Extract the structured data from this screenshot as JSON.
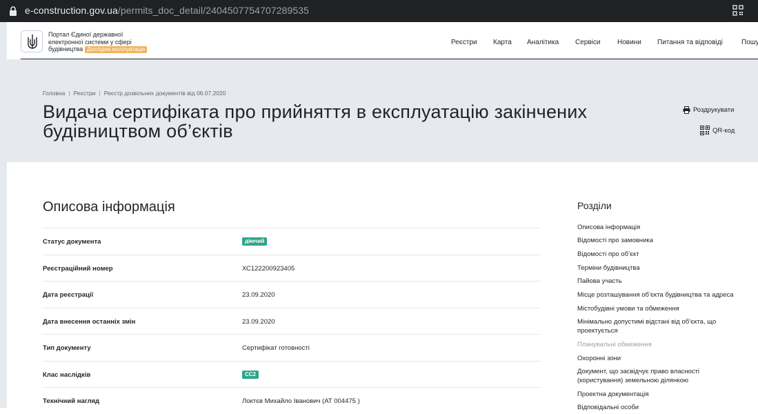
{
  "browser": {
    "url_host": "e-construction.gov.ua",
    "url_path": "/permits_doc_detail/2404507754707289535",
    "lock_icon": "lock-icon",
    "qr_icon": "qr-code-icon"
  },
  "header": {
    "logo_icon": "trident-icon",
    "portal_title": "Портал Єдиної державної електронної системи у сфері будівництва",
    "badge": "Дослідна експлуатація",
    "nav": [
      "Реєстри",
      "Карта",
      "Аналітика",
      "Сервіси",
      "Новини",
      "Питання та відповіді",
      "Пошу"
    ]
  },
  "hero": {
    "breadcrumb": [
      "Головна",
      "Реєстри",
      "Реєстр дозвільних документів від 06.07.2020"
    ],
    "title": "Видача сертифіката про прийняття в експлуатацію закінчених будівництвом об’єктів",
    "print_label": "Роздрукувати",
    "print_icon": "printer-icon",
    "qr_label": "QR-код",
    "qr_icon": "qr-code-icon"
  },
  "main": {
    "section_title": "Описова інформація",
    "rows": [
      {
        "label": "Статус документа",
        "value": "діючий",
        "type": "badge"
      },
      {
        "label": "Реєстраційний номер",
        "value": "ХС122200923405",
        "type": "text"
      },
      {
        "label": "Дата реєстрації",
        "value": "23.09.2020",
        "type": "text"
      },
      {
        "label": "Дата внесення останніх змін",
        "value": "23.09.2020",
        "type": "text"
      },
      {
        "label": "Тип документу",
        "value": "Сертифікат готовності",
        "type": "text"
      },
      {
        "label": "Клас наслідків",
        "value": "СС2",
        "type": "badge"
      },
      {
        "label": "Технічний нагляд",
        "value": "Локтєв Михайло Іванович (АТ 004475 )",
        "type": "text"
      }
    ]
  },
  "toc": {
    "title": "Розділи",
    "items": [
      {
        "label": "Описова інформація",
        "muted": false
      },
      {
        "label": "Відомості про замовника",
        "muted": false
      },
      {
        "label": "Відомості про об’єкт",
        "muted": false
      },
      {
        "label": "Терміни будівництва",
        "muted": false
      },
      {
        "label": "Пайова участь",
        "muted": false
      },
      {
        "label": "Місце розташування об’єкта будівництва та адреса",
        "muted": false
      },
      {
        "label": "Містобудівні умови та обмеження",
        "muted": false
      },
      {
        "label": "Мінімально допустимі відстані від об’єкта, що проектується",
        "muted": false
      },
      {
        "label": "Планувальні обмеження",
        "muted": true
      },
      {
        "label": "Охоронні зони",
        "muted": false
      },
      {
        "label": "Документ, що засвідчує право власності (користування) земельною ділянкою",
        "muted": false
      },
      {
        "label": "Проектна документація",
        "muted": false
      },
      {
        "label": "Відповідальні особи",
        "muted": false
      }
    ]
  },
  "colors": {
    "badge_green": "#2fa58a",
    "hero_bg": "#e6e9ed",
    "logo_badge": "#f2b15f"
  }
}
